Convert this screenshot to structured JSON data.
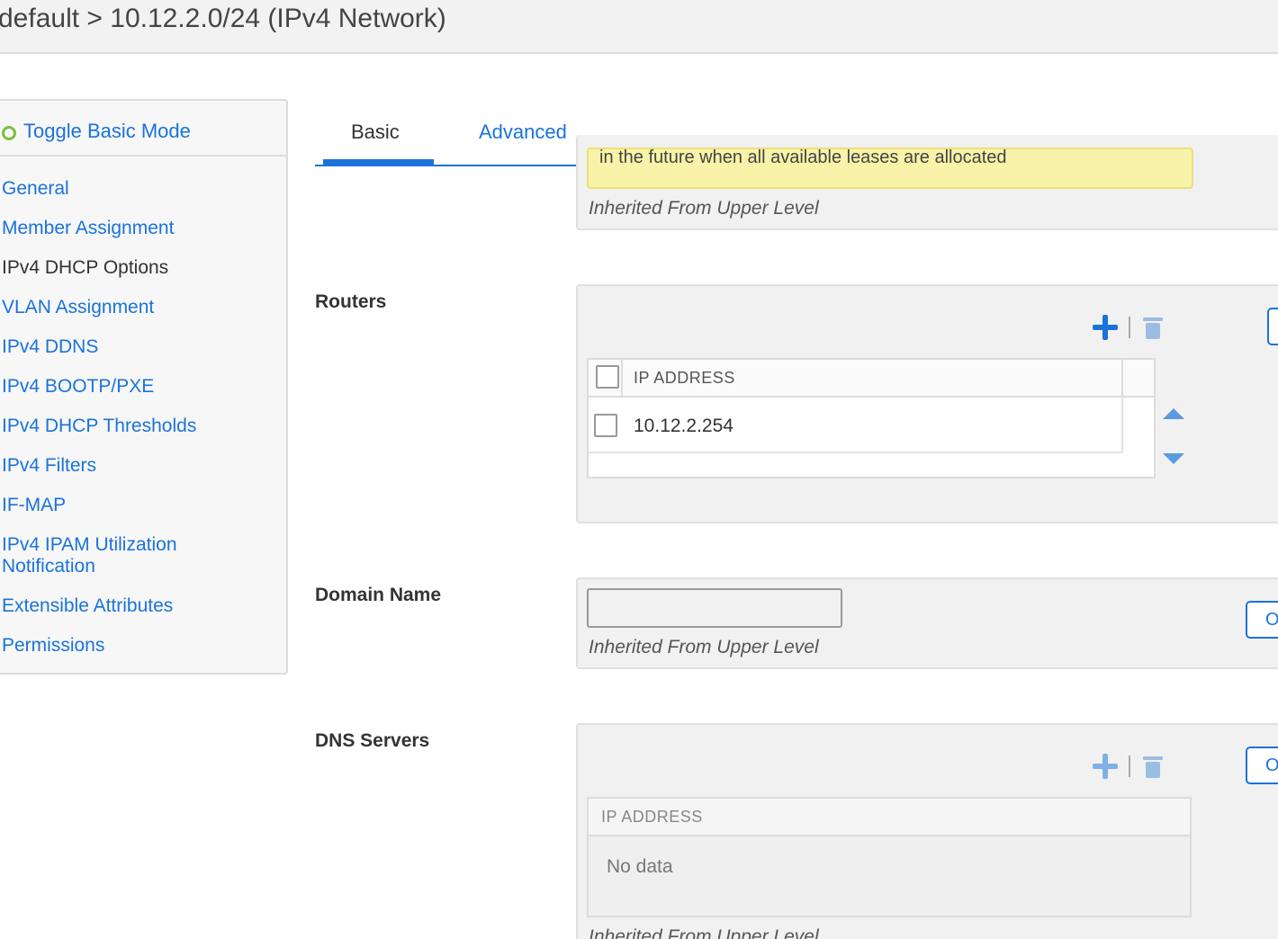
{
  "header": {
    "breadcrumb": "default > 10.12.2.0/24 (IPv4 Network)"
  },
  "sidebar": {
    "toggle_label": "Toggle Basic Mode",
    "items": [
      {
        "label": "General",
        "active": false
      },
      {
        "label": "Member Assignment",
        "active": false
      },
      {
        "label": "IPv4 DHCP Options",
        "active": true
      },
      {
        "label": "VLAN Assignment",
        "active": false
      },
      {
        "label": "IPv4 DDNS",
        "active": false
      },
      {
        "label": "IPv4 BOOTP/PXE",
        "active": false
      },
      {
        "label": "IPv4 DHCP Thresholds",
        "active": false
      },
      {
        "label": "IPv4 Filters",
        "active": false
      },
      {
        "label": "IF-MAP",
        "active": false
      },
      {
        "label": "IPv4 IPAM Utilization",
        "active": false
      },
      {
        "label": "Notification",
        "active": false
      },
      {
        "label": "Extensible Attributes",
        "active": false
      },
      {
        "label": "Permissions",
        "active": false
      }
    ]
  },
  "tabs": [
    {
      "label": "Basic",
      "active": true
    },
    {
      "label": "Advanced",
      "active": false
    }
  ],
  "lease_section": {
    "warning_text": "in the future when all available leases are allocated",
    "inherit_text": "Inherited From Upper Level"
  },
  "routers": {
    "label": "Routers",
    "column_header": "IP ADDRESS",
    "rows": [
      "10.12.2.254"
    ]
  },
  "domain_name": {
    "label": "Domain Name",
    "value": "",
    "inherit_text": "Inherited From Upper Level",
    "override_button": "Override"
  },
  "dns_servers": {
    "label": "DNS Servers",
    "column_header": "IP ADDRESS",
    "empty_text": "No data",
    "inherit_text": "Inherited From Upper Level",
    "override_button": "Override"
  },
  "colors": {
    "accent": "#1a73d9",
    "warning_bg": "#f8f3a8",
    "toggle": "#7bc043"
  }
}
